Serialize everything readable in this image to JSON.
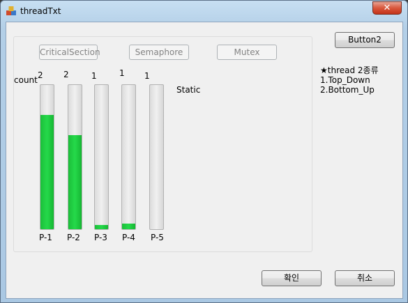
{
  "window": {
    "title": "threadTxt",
    "close_label": "✕"
  },
  "buttons": {
    "critical_section": "CriticalSection",
    "semaphore": "Semaphore",
    "mutex": "Mutex",
    "button2": "Button2",
    "ok": "확인",
    "cancel": "취소"
  },
  "count_label": "count",
  "static_label": "Static",
  "info": {
    "line1": "★thread 2종류",
    "line2": "1.Top_Down",
    "line3": "2.Bottom_Up"
  },
  "progress": [
    {
      "name": "P-1",
      "count": "2",
      "level": 0.79
    },
    {
      "name": "P-2",
      "count": "2",
      "level": 0.65
    },
    {
      "name": "P-3",
      "count": "1",
      "level": 0.03
    },
    {
      "name": "P-4",
      "count": "1",
      "level": 0.04
    },
    {
      "name": "P-5",
      "count": "1",
      "level": 0.0
    }
  ]
}
